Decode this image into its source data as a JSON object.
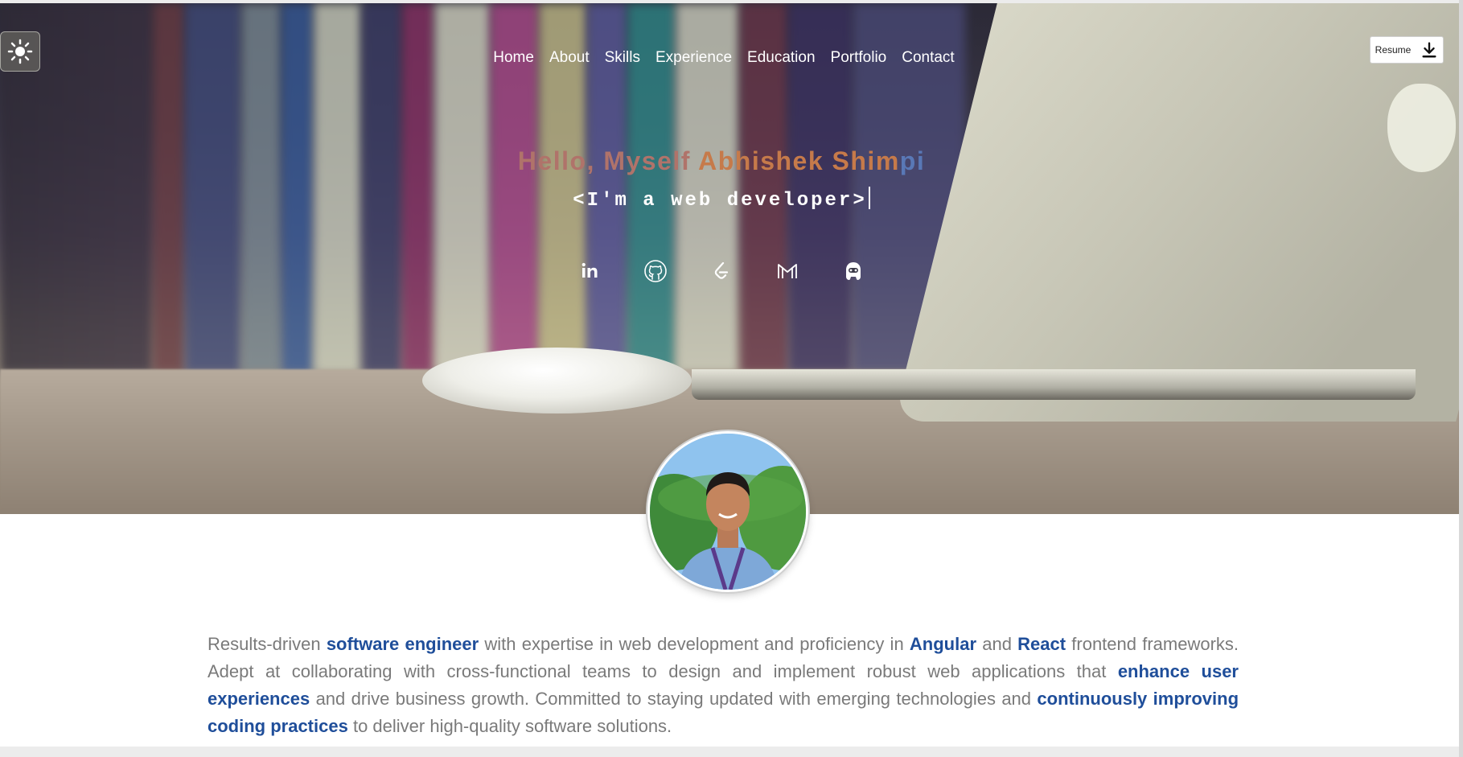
{
  "nav": {
    "items": [
      "Home",
      "About",
      "Skills",
      "Experience",
      "Education",
      "Portfolio",
      "Contact"
    ]
  },
  "theme_toggle": {
    "icon": "sun-icon"
  },
  "resume": {
    "label": "Resume",
    "icon": "download-icon"
  },
  "hero": {
    "greeting_part1": "Hello, Myself ",
    "greeting_part2": "Abhishek Shim",
    "greeting_part3": "pi",
    "tagline": "<I'm a web developer>",
    "greeting_colors": [
      "#b0736a",
      "#c67a4a",
      "#5978b6"
    ]
  },
  "socials": [
    {
      "icon": "linkedin-icon"
    },
    {
      "icon": "github-icon"
    },
    {
      "icon": "leetcode-icon"
    },
    {
      "icon": "gmail-icon"
    },
    {
      "icon": "hackerrank-icon"
    }
  ],
  "about": {
    "t1": "Results-driven ",
    "b1": "software engineer",
    "t2": " with expertise in web development and proficiency in ",
    "b2": "Angular",
    "t3": " and ",
    "b3": "React",
    "t4": " frontend frameworks. Adept at collaborating with cross-functional teams to design and implement robust web applications that ",
    "b4": "enhance user experiences",
    "t5": " and drive business growth. Committed to staying updated with emerging technologies and ",
    "b5": "continuously improving coding practices",
    "t6": " to deliver high-quality software solutions.",
    "highlight_color": "#1f4e9a"
  }
}
